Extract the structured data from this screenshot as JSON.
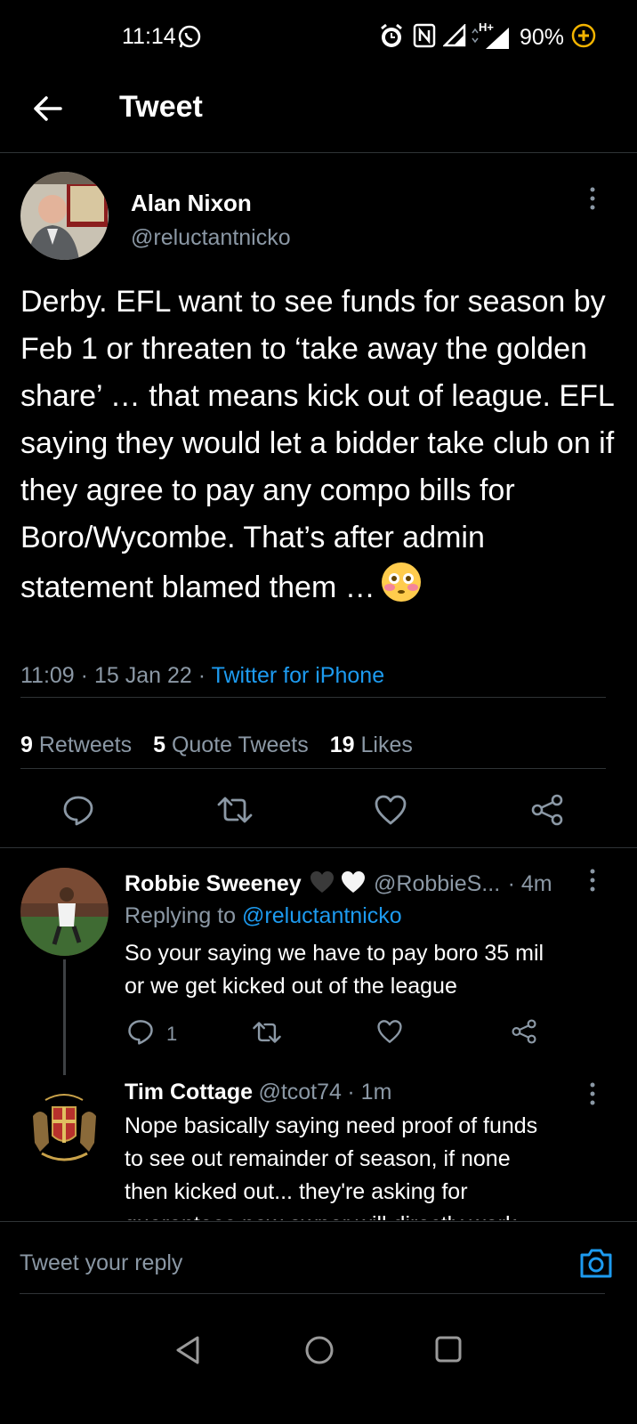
{
  "status_bar": {
    "time": "11:14",
    "battery": "90%",
    "network": "H+",
    "icons": [
      "whatsapp-icon",
      "alarm-icon",
      "nfc-icon",
      "signal-icon",
      "signal-hplus-icon",
      "battery-saver-icon"
    ]
  },
  "header": {
    "title": "Tweet",
    "back_icon": "back-arrow-icon"
  },
  "tweet": {
    "author_name": "Alan Nixon",
    "author_handle": "@reluctantnicko",
    "text": "Derby. EFL want to see funds for season by Feb 1 or threaten to ‘take away the golden share’ … that means kick out of league. EFL saying they would let a bidder take club on if they agree to pay any compo bills for Boro/Wycombe. That’s after admin statement blamed them …",
    "emoji": "flushed-face",
    "time": "11:09",
    "date": "15 Jan 22",
    "separator": "·",
    "source": "Twitter for iPhone",
    "retweets_count": "9",
    "retweets_label": "Retweets",
    "quotes_count": "5",
    "quotes_label": "Quote Tweets",
    "likes_count": "19",
    "likes_label": "Likes"
  },
  "replies": [
    {
      "name": "Robbie Sweeney",
      "handle": "@RobbieS...",
      "time": "· 4m",
      "replying_prefix": "Replying to ",
      "replying_handle": "@reluctantnicko",
      "text_line1": "So your saying we have to pay boro 35 mil",
      "text_line2": "or we get kicked out of the league",
      "reply_count": "1"
    },
    {
      "name": "Tim Cottage",
      "handle": "@tcot74",
      "time": "· 1m",
      "text_line1": "Nope basically saying need proof of funds",
      "text_line2": "to see out remainder of season, if none",
      "text_line3": "then kicked out... they're asking for",
      "text_line4": "guarantees new owner will directly work"
    }
  ],
  "reply_bar": {
    "placeholder": "Tweet your reply"
  },
  "colors": {
    "background": "#000000",
    "accent": "#1d9bf0",
    "muted": "#8b98a5",
    "divider": "#2f3336",
    "battery_saver": "#f4b400"
  }
}
